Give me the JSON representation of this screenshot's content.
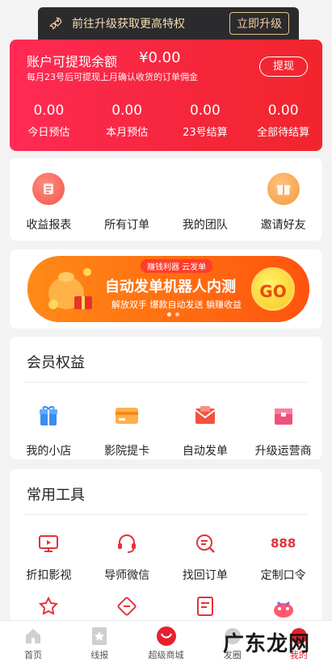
{
  "upgrade": {
    "text": "前往升级获取更高特权",
    "button": "立即升级"
  },
  "balance": {
    "title": "账户可提现余额",
    "amount": "¥0.00",
    "note": "每月23号后可提现上月确认收货的订单佣金",
    "withdraw": "提现",
    "stats": [
      {
        "value": "0.00",
        "label": "今日预估"
      },
      {
        "value": "0.00",
        "label": "本月预估"
      },
      {
        "value": "0.00",
        "label": "23号结算"
      },
      {
        "value": "0.00",
        "label": "全部待结算"
      }
    ]
  },
  "quick": [
    {
      "label": "收益报表",
      "icon": "report-icon"
    },
    {
      "label": "所有订单",
      "icon": "orders-icon"
    },
    {
      "label": "我的团队",
      "icon": "team-icon"
    },
    {
      "label": "邀请好友",
      "icon": "gift-icon"
    }
  ],
  "banner": {
    "tag": "赚钱利器 云发单",
    "headline": "自动发单机器人内测",
    "sub": "解放双手 爆款自动发送 躺赚收益",
    "go": "GO"
  },
  "vip": {
    "title": "会员权益",
    "items": [
      {
        "label": "我的小店",
        "icon": "shop-icon"
      },
      {
        "label": "影院提卡",
        "icon": "card-icon"
      },
      {
        "label": "自动发单",
        "icon": "mail-icon"
      },
      {
        "label": "升级运营商",
        "icon": "upgrade-box-icon"
      }
    ]
  },
  "tools": {
    "title": "常用工具",
    "items": [
      {
        "label": "折扣影视",
        "icon": "tv-icon"
      },
      {
        "label": "导师微信",
        "icon": "headset-icon"
      },
      {
        "label": "找回订单",
        "icon": "search-order-icon"
      },
      {
        "label": "定制口令",
        "icon": "888"
      }
    ]
  },
  "tabbar": [
    {
      "label": "首页",
      "icon": "home-icon"
    },
    {
      "label": "线报",
      "icon": "star-doc-icon"
    },
    {
      "label": "超级商城",
      "icon": "mall-icon"
    },
    {
      "label": "发圈",
      "icon": "share-icon"
    },
    {
      "label": "我的",
      "icon": "profile-icon"
    }
  ],
  "watermark": "广东龙网",
  "colors": {
    "primary": "#f2252d",
    "accent": "#ff7a10",
    "dark": "#2b2b2e"
  }
}
